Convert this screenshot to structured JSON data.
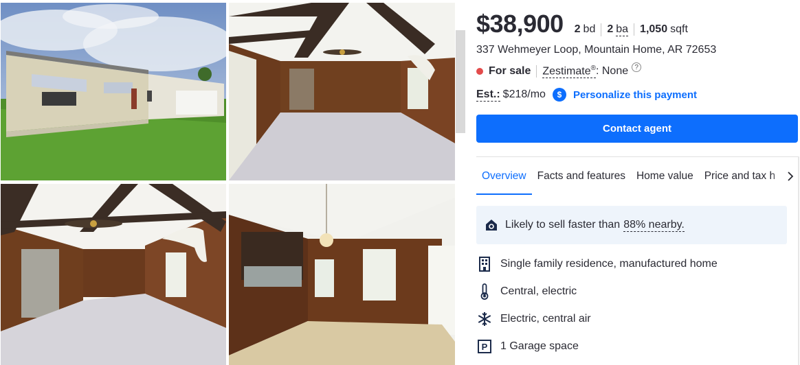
{
  "listing": {
    "price": "$38,900",
    "beds_value": "2",
    "beds_unit": "bd",
    "baths_value": "2",
    "baths_unit": "ba",
    "sqft_value": "1,050",
    "sqft_unit": "sqft",
    "address": "337 Wehmeyer Loop, Mountain Home, AR 72653",
    "status": "For sale",
    "status_color": "#e34b4b",
    "zestimate_label": "Zestimate",
    "zestimate_reg": "®",
    "zestimate_value": ": None",
    "help_glyph": "?",
    "est_label": "Est.:",
    "est_value": "$218/mo",
    "dollar_glyph": "$",
    "personalize_label": "Personalize this payment",
    "contact_label": "Contact agent",
    "accent_color": "#0d6efd"
  },
  "tabs": [
    {
      "label": "Overview",
      "active": true
    },
    {
      "label": "Facts and features",
      "active": false
    },
    {
      "label": "Home value",
      "active": false
    },
    {
      "label": "Price and tax h",
      "active": false
    }
  ],
  "insight": {
    "text": "Likely to sell faster than",
    "percent": "88% nearby."
  },
  "features": [
    {
      "icon": "building-icon",
      "text": "Single family residence, manufactured home"
    },
    {
      "icon": "thermometer-icon",
      "text": "Central, electric"
    },
    {
      "icon": "snowflake-icon",
      "text": "Electric, central air"
    },
    {
      "icon": "parking-icon",
      "text": "1 Garage space"
    }
  ],
  "photos": [
    {
      "name": "exterior-photo"
    },
    {
      "name": "living-room-photo"
    },
    {
      "name": "living-room-ceiling-fan-photo"
    },
    {
      "name": "dining-room-photo"
    }
  ]
}
